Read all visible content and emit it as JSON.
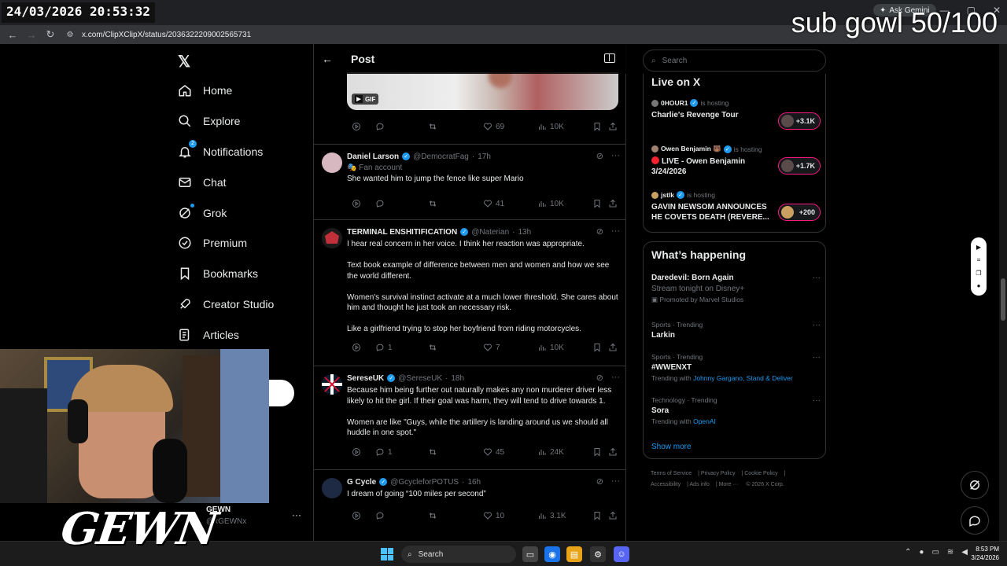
{
  "overlay": {
    "timestamp": "24/03/2026 20:53:32",
    "sub_goal": "sub gowl 50/100",
    "streamer_logo": "GEWN"
  },
  "browser": {
    "url": "x.com/ClipXClipX/status/2036322209002565731",
    "ask_gemini": "Ask Gemini"
  },
  "nav": {
    "items": [
      {
        "label": "Home",
        "icon": "home-icon"
      },
      {
        "label": "Explore",
        "icon": "search-icon"
      },
      {
        "label": "Notifications",
        "icon": "bell-icon",
        "badge": "2"
      },
      {
        "label": "Chat",
        "icon": "mail-icon"
      },
      {
        "label": "Grok",
        "icon": "grok-icon"
      },
      {
        "label": "Premium",
        "icon": "premium-icon"
      },
      {
        "label": "Bookmarks",
        "icon": "bookmark-icon"
      },
      {
        "label": "Creator Studio",
        "icon": "rocket-icon"
      },
      {
        "label": "Articles",
        "icon": "article-icon"
      }
    ],
    "account_name": "GEWN",
    "account_handle": "@xGEWNx"
  },
  "header": {
    "title": "Post"
  },
  "media": {
    "badge": "GIF"
  },
  "top_actions": {
    "likes": "69",
    "views": "10K"
  },
  "tweets": [
    {
      "name": "Daniel Larson",
      "handle": "@DemocratFag",
      "time": "17h",
      "sub": "Fan account",
      "text": "She wanted him to jump the fence like super Mario",
      "replies": "",
      "likes": "41",
      "views": "10K"
    },
    {
      "name": "TERMINAL ENSHITIFICATION",
      "handle": "@Naterian",
      "time": "13h",
      "sub": "",
      "text": "I hear real concern in her voice. I think her reaction was appropriate.\n\nText book example of difference between men and women and how we see the world different.\n\nWomen's survival instinct activate at a much lower threshold. She cares about him and thought he just took an necessary risk.\n\nLike a girlfriend trying to stop her boyfriend from riding motorcycles.",
      "replies": "1",
      "likes": "7",
      "views": "10K"
    },
    {
      "name": "SereseUK",
      "handle": "@SereseUK",
      "time": "18h",
      "sub": "",
      "text": "Because him being further out naturally makes any non murderer driver less likely to hit the girl. If their goal was harm, they will tend to drive towards 1.\n\nWomen are like \"Guys, while the artillery is landing around us we should all huddle in one spot.\"",
      "replies": "1",
      "likes": "45",
      "views": "24K"
    },
    {
      "name": "G Cycle",
      "handle": "@GcycleforPOTUS",
      "time": "16h",
      "sub": "",
      "text": "I dream of going “100 miles per second”",
      "replies": "",
      "likes": "10",
      "views": "3.1K"
    }
  ],
  "right": {
    "search_placeholder": "Search",
    "live_title": "Live on X",
    "live": [
      {
        "host": "0HOUR1",
        "hosting": "is hosting",
        "title": "Charlie's Revenge Tour",
        "count": "+3.1K",
        "red_dot": false
      },
      {
        "host": "Owen Benjamin 🐻",
        "hosting": "is hosting",
        "title": "LIVE - Owen Benjamin 3/24/2026",
        "count": "+1.7K",
        "red_dot": true
      },
      {
        "host": "jstlk",
        "hosting": "is hosting",
        "title": "GAVIN NEWSOM ANNOUNCES HE COVETS DEATH (REVERE...",
        "count": "+200",
        "red_dot": false
      }
    ],
    "happening_title": "What’s happening",
    "trends": [
      {
        "category": "",
        "name": "Daredevil: Born Again",
        "sub": "Stream tonight on Disney+",
        "promo": "Promoted by Marvel Studios",
        "with": ""
      },
      {
        "category": "Sports · Trending",
        "name": "Larkin",
        "sub": "",
        "promo": "",
        "with": ""
      },
      {
        "category": "Sports · Trending",
        "name": "#WWENXT",
        "sub": "Trending with",
        "promo": "",
        "with": "Johnny Gargano, Stand & Deliver"
      },
      {
        "category": "Technology · Trending",
        "name": "Sora",
        "sub": "Trending with",
        "promo": "",
        "with": "OpenAI"
      }
    ],
    "show_more": "Show more",
    "footer": [
      "Terms of Service",
      "Privacy Policy",
      "Cookie Policy",
      "Accessibility",
      "Ads info",
      "More ···",
      "© 2026 X Corp."
    ]
  },
  "taskbar": {
    "search": "Search",
    "time": "8:53 PM",
    "date": "3/24/2026"
  }
}
